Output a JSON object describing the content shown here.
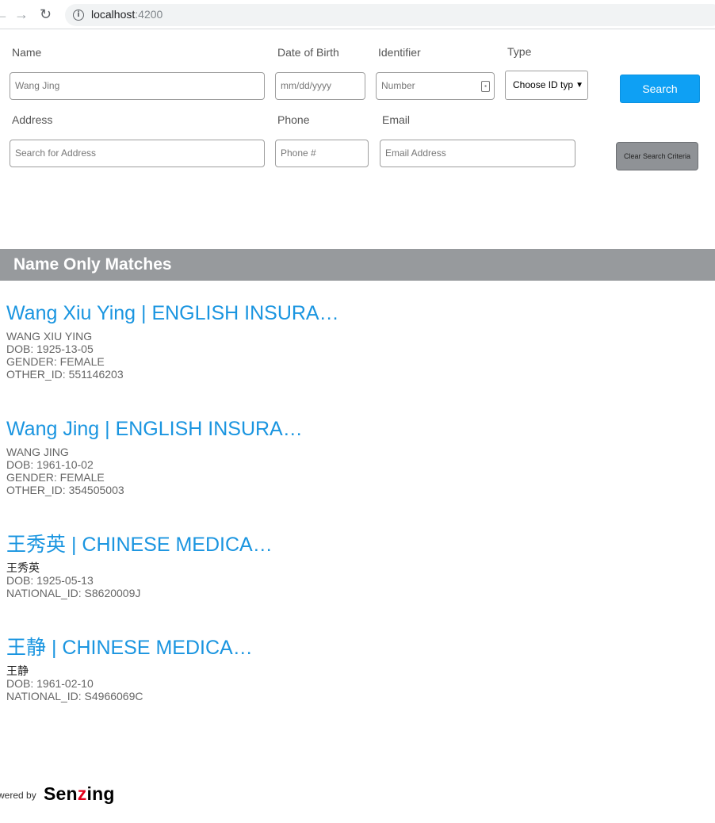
{
  "browser": {
    "url_host": "localhost",
    "url_port": ":4200"
  },
  "form": {
    "name_label": "Name",
    "name_placeholder": "Wang Jing",
    "dob_label": "Date of Birth",
    "dob_placeholder": "mm/dd/yyyy",
    "identifier_label": "Identifier",
    "identifier_placeholder": "Number",
    "type_label": "Type",
    "type_value": "Choose ID typ",
    "search_button": "Search",
    "address_label": "Address",
    "address_placeholder": "Search for Address",
    "phone_label": "Phone",
    "phone_placeholder": "Phone #",
    "email_label": "Email",
    "email_placeholder": "Email Address",
    "clear_button": "Clear Search Criteria"
  },
  "results": {
    "section_title": "Name Only Matches",
    "items": [
      {
        "title": "Wang Xiu Ying | ENGLISH INSURA…",
        "lines": [
          "WANG XIU YING",
          "DOB: 1925-13-05",
          "GENDER: FEMALE",
          "OTHER_ID: 551146203"
        ]
      },
      {
        "title": "Wang Jing | ENGLISH INSURA…",
        "lines": [
          "WANG JING",
          "DOB: 1961-10-02",
          "GENDER: FEMALE",
          "OTHER_ID: 354505003"
        ]
      },
      {
        "title": "王秀英 | CHINESE MEDICA…",
        "lines": [
          "王秀英",
          "DOB: 1925-05-13",
          "NATIONAL_ID: S8620009J"
        ]
      },
      {
        "title": "王静 | CHINESE MEDICA…",
        "lines": [
          "王静",
          "DOB: 1961-02-10",
          "NATIONAL_ID: S4966069C"
        ]
      }
    ]
  },
  "footer": {
    "powered_by": "wered by",
    "brand_pre": "Sen",
    "brand_z": "z",
    "brand_post": "ing"
  },
  "colors": {
    "link_blue": "#1a95e0",
    "search_button": "#0ea0f4",
    "section_header": "#979a9d",
    "brand_red": "#e3001b"
  }
}
